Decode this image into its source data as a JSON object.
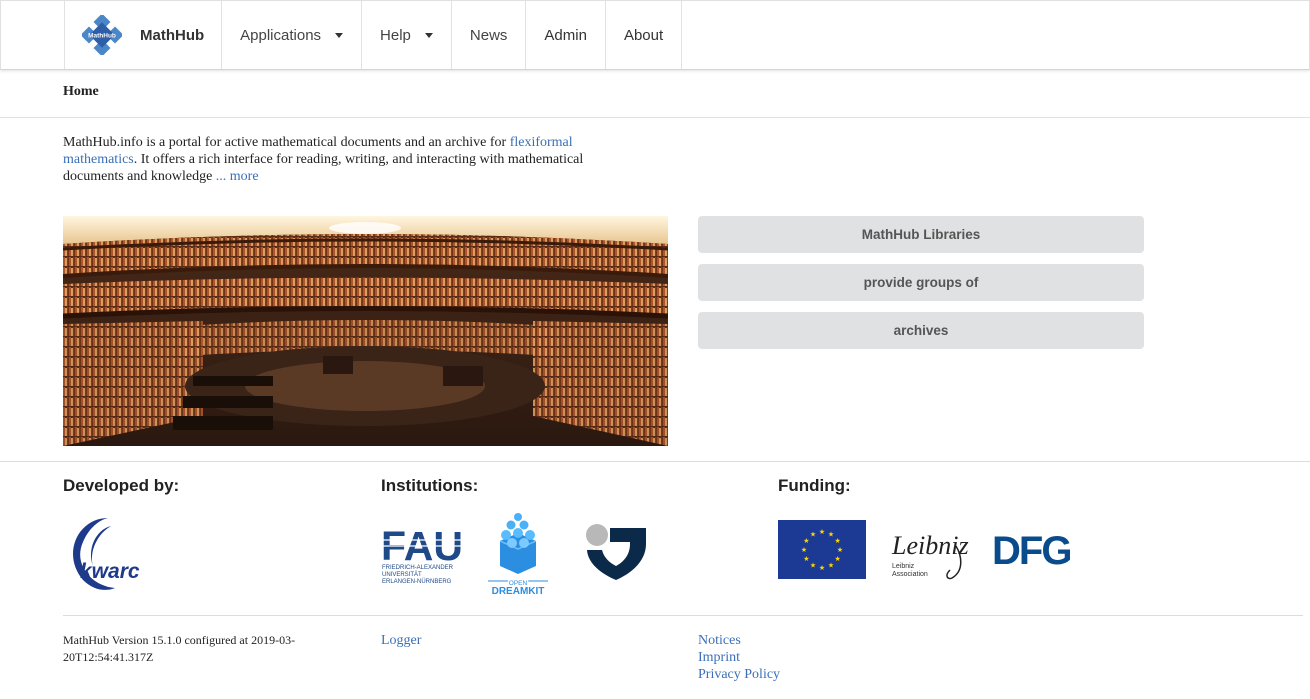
{
  "nav": {
    "brand": "MathHub",
    "logo_text": "MathHub",
    "items": [
      {
        "label": "Applications",
        "dropdown": true
      },
      {
        "label": "Help",
        "dropdown": true
      },
      {
        "label": "News",
        "dropdown": false
      },
      {
        "label": "Admin",
        "dropdown": false
      },
      {
        "label": "About",
        "dropdown": false
      }
    ]
  },
  "breadcrumb": "Home",
  "intro": {
    "text1": "MathHub.info is a portal for active mathematical documents and an archive for ",
    "link1": "flexiformal mathematics",
    "text2": ". It offers a rich interface for reading, writing, and interacting with mathematical documents and knowledge ",
    "more": "... more"
  },
  "side_buttons": [
    "MathHub Libraries",
    "provide groups of",
    "archives"
  ],
  "footer": {
    "developed_by": "Developed by:",
    "institutions": "Institutions:",
    "funding": "Funding:",
    "kwarc_text": "kwarc",
    "fau_text": "FAU",
    "fau_sub1": "FRIEDRICH-ALEXANDER",
    "fau_sub2": "UNIVERSITÄT",
    "fau_sub3": "ERLANGEN-NÜRNBERG",
    "odk_text1": "OPEN",
    "odk_text2": "DREAMKIT",
    "leibniz_text": "Leibniz",
    "leibniz_sub1": "Leibniz",
    "leibniz_sub2": "Association",
    "dfg_text": "DFG",
    "version": "MathHub Version 15.1.0 configured at 2019-03-20T12:54:41.317Z",
    "logger": "Logger",
    "notices": "Notices",
    "imprint": "Imprint",
    "privacy": "Privacy Policy"
  },
  "colors": {
    "link": "#3a6fb8",
    "button_bg": "#e0e1e2",
    "eu_blue": "#1c3a94",
    "dfg_blue": "#0a4b8c",
    "kwarc_blue": "#1e3a8a"
  }
}
